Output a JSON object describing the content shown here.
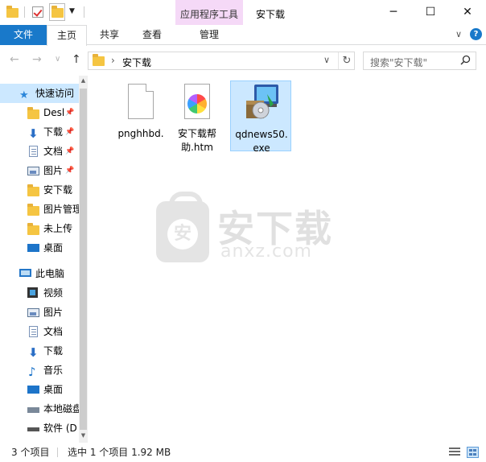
{
  "window": {
    "title": "安下载",
    "context_tab_group": "应用程序工具",
    "minimize": "─",
    "maximize": "☐",
    "close": "✕"
  },
  "ribbon": {
    "tabs": [
      {
        "label": "文件"
      },
      {
        "label": "主页"
      },
      {
        "label": "共享"
      },
      {
        "label": "查看"
      },
      {
        "label": "管理"
      }
    ],
    "expand": "∨",
    "help": "?"
  },
  "address": {
    "path": "安下载",
    "separator": "›",
    "dropdown": "∨",
    "refresh": "↻"
  },
  "search": {
    "placeholder": "搜索\"安下载\""
  },
  "nav_buttons": {
    "back": "←",
    "forward": "→",
    "recent": "∨",
    "up": "↑"
  },
  "navigation": {
    "quick_access": "快速访问",
    "quick_items": [
      {
        "label": "Desl",
        "icon": "folder-icon",
        "pinned": true
      },
      {
        "label": "下载",
        "icon": "download-icon",
        "pinned": true
      },
      {
        "label": "文档",
        "icon": "document-icon",
        "pinned": true
      },
      {
        "label": "图片",
        "icon": "pictures-icon",
        "pinned": true
      },
      {
        "label": "安下载",
        "icon": "folder-icon"
      },
      {
        "label": "图片管理",
        "icon": "folder-icon"
      },
      {
        "label": "未上传",
        "icon": "folder-icon"
      },
      {
        "label": "桌面",
        "icon": "desktop-icon"
      }
    ],
    "this_pc": "此电脑",
    "pc_items": [
      {
        "label": "视频",
        "icon": "video-icon"
      },
      {
        "label": "图片",
        "icon": "pictures-icon"
      },
      {
        "label": "文档",
        "icon": "document-icon"
      },
      {
        "label": "下载",
        "icon": "download-icon"
      },
      {
        "label": "音乐",
        "icon": "music-icon"
      },
      {
        "label": "桌面",
        "icon": "desktop-icon"
      },
      {
        "label": "本地磁盘",
        "icon": "drive-icon"
      },
      {
        "label": "软件 (D",
        "icon": "drive-icon"
      }
    ],
    "pin_glyph": "📌"
  },
  "files": [
    {
      "name": "pnghhbd.",
      "icon": "blank-file-icon",
      "selected": false
    },
    {
      "name_lines": [
        "安下载帮",
        "助.htm"
      ],
      "icon": "html-file-icon",
      "selected": false
    },
    {
      "name_lines": [
        "qdnews50.",
        "exe"
      ],
      "icon": "installer-icon",
      "selected": true
    }
  ],
  "watermark": {
    "badge": "安",
    "title": "安下载",
    "subtitle": "anxz.com"
  },
  "status": {
    "item_count": "3 个项目",
    "selection": "选中 1 个项目  1.92 MB"
  },
  "colors": {
    "accent": "#1979ca",
    "selection": "#cce8ff",
    "context_tab": "#f5d9f7"
  }
}
